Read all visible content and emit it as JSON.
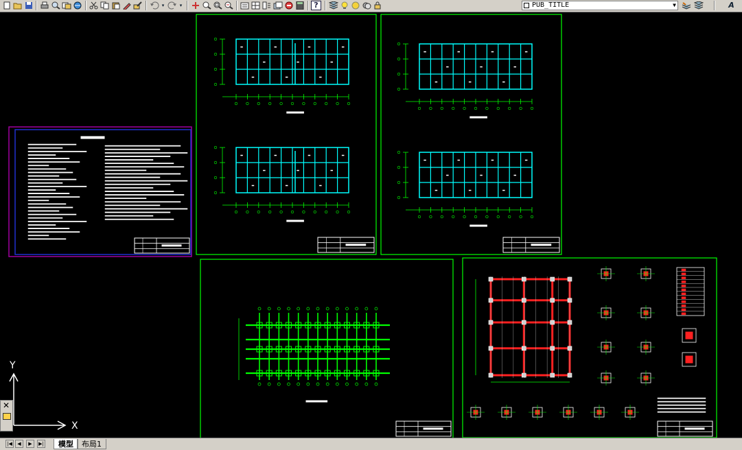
{
  "toolbar": {
    "layer_name": "PUB_TITLE",
    "help_glyph": "?"
  },
  "ucs": {
    "x_label": "X",
    "y_label": "Y"
  },
  "tabs": [
    {
      "label": "模型",
      "active": true
    },
    {
      "label": "布局1",
      "active": false
    }
  ],
  "colors": {
    "background": "#000000",
    "toolbar": "#d4d0c8",
    "frame": "#00ff00",
    "plan_grid": "#00ffff",
    "dimension": "#00ff00",
    "column_red": "#ff2020",
    "title_frame": "#a000a0",
    "text": "#ffffff"
  },
  "icons": [
    "new-icon",
    "open-icon",
    "save-icon",
    "print-icon",
    "preview-icon",
    "publish-icon",
    "3d-dwf-icon",
    "cut-icon",
    "copy-icon",
    "paste-icon",
    "match-properties-icon",
    "block-editor-icon",
    "undo-icon",
    "redo-icon",
    "pan-icon",
    "zoom-realtime-icon",
    "zoom-window-icon",
    "zoom-previous-icon",
    "properties-icon",
    "design-center-icon",
    "tool-palettes-icon",
    "sheet-set-icon",
    "markup-icon",
    "calculator-icon",
    "help-icon",
    "layer-manager-icon",
    "layer-on-icon",
    "layer-freeze-icon",
    "layer-lock-icon",
    "layer-previous-icon",
    "layer-states-icon",
    "text-style-icon"
  ]
}
